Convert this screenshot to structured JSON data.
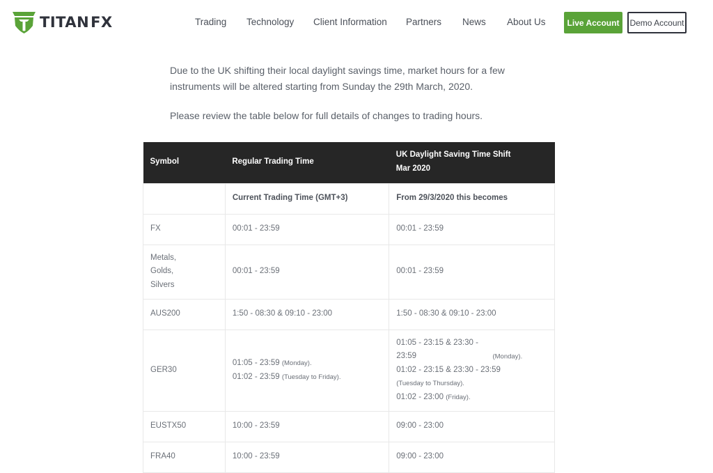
{
  "header": {
    "logo": {
      "text_main": "TITAN",
      "text_suffix": "FX",
      "icon": "shield-logo-icon",
      "brand_color": "#5aa338"
    },
    "nav": [
      {
        "label": "Trading"
      },
      {
        "label": "Technology"
      },
      {
        "label": "Client Information"
      },
      {
        "label": "Partners"
      },
      {
        "label": "News"
      },
      {
        "label": "About Us"
      }
    ],
    "live_account_label": "Live Account",
    "demo_account_label": "Demo Account"
  },
  "intro": {
    "paragraph1": "Due to the UK shifting their local daylight savings time, market hours for a few instruments will be altered starting from Sunday the 29th March, 2020.",
    "paragraph2": "Please review the table below for full details of changes to trading hours."
  },
  "table": {
    "headers": {
      "symbol": "Symbol",
      "regular": "Regular Trading Time",
      "shift_line1": "UK Daylight Saving Time Shift",
      "shift_line2": "Mar 2020"
    },
    "subheaders": {
      "symbol": "",
      "regular": "Current Trading Time (GMT+3)",
      "shift": "From 29/3/2020 this becomes"
    },
    "rows": [
      {
        "symbol": "FX",
        "regular": "00:01 - 23:59",
        "shift": "00:01 - 23:59"
      },
      {
        "symbol_lines": [
          "Metals,",
          "Golds,",
          "Silvers"
        ],
        "regular": "00:01 - 23:59",
        "shift": "00:01 - 23:59"
      },
      {
        "symbol": "AUS200",
        "regular": "1:50 - 08:30 & 09:10 - 23:00",
        "shift": "1:50 - 08:30 & 09:10 - 23:00"
      },
      {
        "symbol": "GER30",
        "regular_parts": [
          {
            "time": "01:05 - 23:59",
            "note": "(Monday)."
          },
          {
            "time": "01:02 - 23:59",
            "note": "(Tuesday to Friday)."
          }
        ],
        "shift_parts": [
          {
            "time": "01:05 - 23:15 & 23:30 - 23:59",
            "note": "(Monday)."
          },
          {
            "time": "01:02 - 23:15 & 23:30 - 23:59",
            "note": "(Tuesday to Thursday)."
          },
          {
            "time": "01:02 - 23:00",
            "note": "(Friday)."
          }
        ]
      },
      {
        "symbol": "EUSTX50",
        "regular": "10:00 - 23:59",
        "shift": "09:00 - 23:00"
      },
      {
        "symbol": "FRA40",
        "regular": "10:00 - 23:59",
        "shift": "09:00 - 23:00"
      }
    ]
  }
}
